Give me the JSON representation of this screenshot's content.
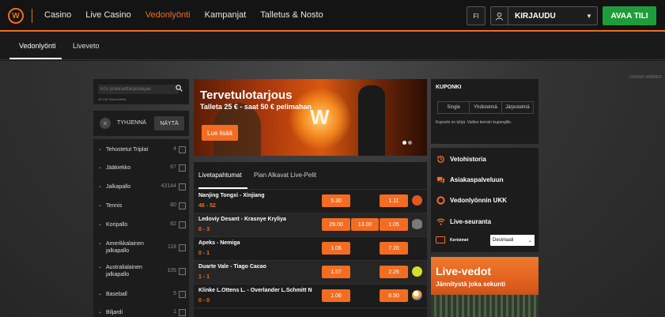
{
  "header": {
    "logo_letter": "W",
    "nav": [
      {
        "label": "Casino",
        "active": false
      },
      {
        "label": "Live Casino",
        "active": false
      },
      {
        "label": "Vedonlyönti",
        "active": true
      },
      {
        "label": "Kampanjat",
        "active": false
      },
      {
        "label": "Talletus & Nosto",
        "active": false
      }
    ],
    "language": "FI",
    "login_label": "KIRJAUDU",
    "join_label": "AVAA TILI"
  },
  "subnav": {
    "tabs": [
      "Vedonlyönti",
      "Liveveto"
    ]
  },
  "watermark": "CASINO WINNER",
  "sidebar": {
    "search_placeholder": "Etsi joukkuetta/pelaajaa",
    "event_count": "46 136 Vetokohteita",
    "clear_label": "TYHJENNÄ",
    "show_label": "NÄYTÄ",
    "sports": [
      {
        "name": "Tehostetut Triplat",
        "count": "4"
      },
      {
        "name": "Jääkiekko",
        "count": "67"
      },
      {
        "name": "Jalkapallo",
        "count": "43144"
      },
      {
        "name": "Tennis",
        "count": "80"
      },
      {
        "name": "Koripallo",
        "count": "82"
      },
      {
        "name": "Amerikkalainen jalkapallo",
        "count": "118"
      },
      {
        "name": "Australialainen jalkapallo",
        "count": "105"
      },
      {
        "name": "Baseball",
        "count": "5"
      },
      {
        "name": "Biljardi",
        "count": "1"
      }
    ]
  },
  "banner": {
    "title": "Tervetulotarjous",
    "subtitle": "Talleta 25 € - saat 50 € pelimahan",
    "cta": "Lue lisää"
  },
  "events": {
    "tabs": [
      "Livetapahtumat",
      "Pian Alkavat Live-Pelit"
    ],
    "rows": [
      {
        "teams": "Nanjing Tongxi - Xinjiang",
        "score": "46 - 52",
        "odds": [
          "5.30",
          "1.11"
        ],
        "sport": "basketball",
        "icon_color": "#e0581c"
      },
      {
        "teams": "Ledoviy Desant - Krasnye Kryliya",
        "score": "0 - 3",
        "odds": [
          "29.00",
          "13.00",
          "1.05"
        ],
        "sport": "hockey",
        "icon_color": "#8a8a8a"
      },
      {
        "teams": "Apeks - Nemiga",
        "score": "0 - 1",
        "odds": [
          "1.06",
          "7.20"
        ],
        "sport": "none",
        "icon_color": ""
      },
      {
        "teams": "Duarte Vale - Tiago Cacao",
        "score": "1 - 1",
        "odds": [
          "1.57",
          "2.26"
        ],
        "sport": "tennis",
        "icon_color": "#d6df26"
      },
      {
        "teams": "Klinke L.Ottens L. - Overlander L.Schmitt N",
        "score": "0 - 0",
        "odds": [
          "1.06",
          "8.50"
        ],
        "sport": "volleyball",
        "icon_color": "#f2a23a"
      }
    ]
  },
  "coupon": {
    "title": "KUPONKI",
    "tabs": [
      "Single",
      "Yhdistelmä",
      "Järjestelmä"
    ],
    "empty_text": "Kuponki on tyhjä. Valitse kerroin kupongille."
  },
  "links": [
    {
      "label": "Vetohistoria",
      "icon": "history-icon"
    },
    {
      "label": "Asiakaspalveluun",
      "icon": "chat-icon"
    },
    {
      "label": "Vedonlyönnin UKK",
      "icon": "lifebuoy-icon"
    },
    {
      "label": "Live-seuranta",
      "icon": "wifi-icon"
    }
  ],
  "odds_format": {
    "label": "Kertoimet",
    "selected": "Desimaali"
  },
  "live_promo": {
    "title": "Live-vedot",
    "subtitle": "Jännitystä joka sekunti"
  },
  "colors": {
    "accent": "#f26d21",
    "join": "#1f9c3a"
  }
}
